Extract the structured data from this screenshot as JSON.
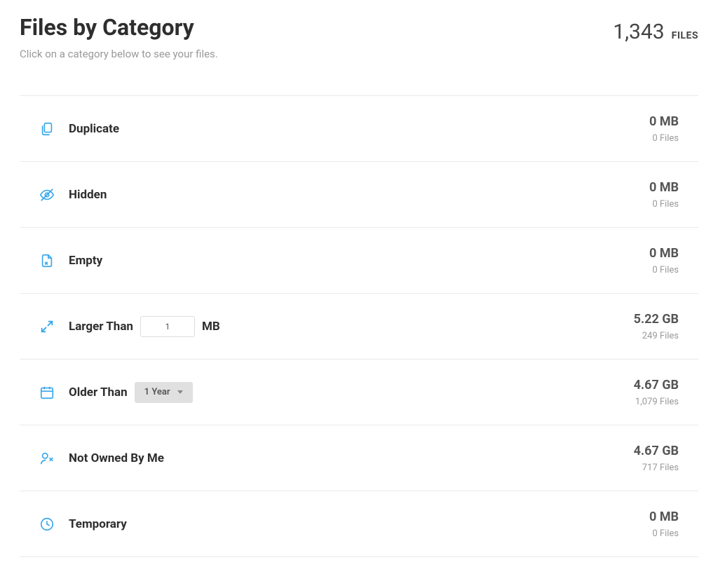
{
  "header": {
    "title": "Files by Category",
    "subtitle": "Click on a category below to see your files.",
    "total_count": "1,343",
    "total_label": "FILES"
  },
  "categories": [
    {
      "icon": "duplicate",
      "label": "Duplicate",
      "size": "0 MB",
      "files": "0 Files"
    },
    {
      "icon": "hidden",
      "label": "Hidden",
      "size": "0 MB",
      "files": "0 Files"
    },
    {
      "icon": "empty",
      "label": "Empty",
      "size": "0 MB",
      "files": "0 Files"
    },
    {
      "icon": "larger",
      "label_prefix": "Larger Than",
      "input_value": "1",
      "unit": "MB",
      "size": "5.22 GB",
      "files": "249 Files"
    },
    {
      "icon": "older",
      "label_prefix": "Older Than",
      "dropdown_value": "1 Year",
      "size": "4.67 GB",
      "files": "1,079 Files"
    },
    {
      "icon": "notowned",
      "label": "Not Owned By Me",
      "size": "4.67 GB",
      "files": "717 Files"
    },
    {
      "icon": "temporary",
      "label": "Temporary",
      "size": "0 MB",
      "files": "0 Files"
    }
  ]
}
